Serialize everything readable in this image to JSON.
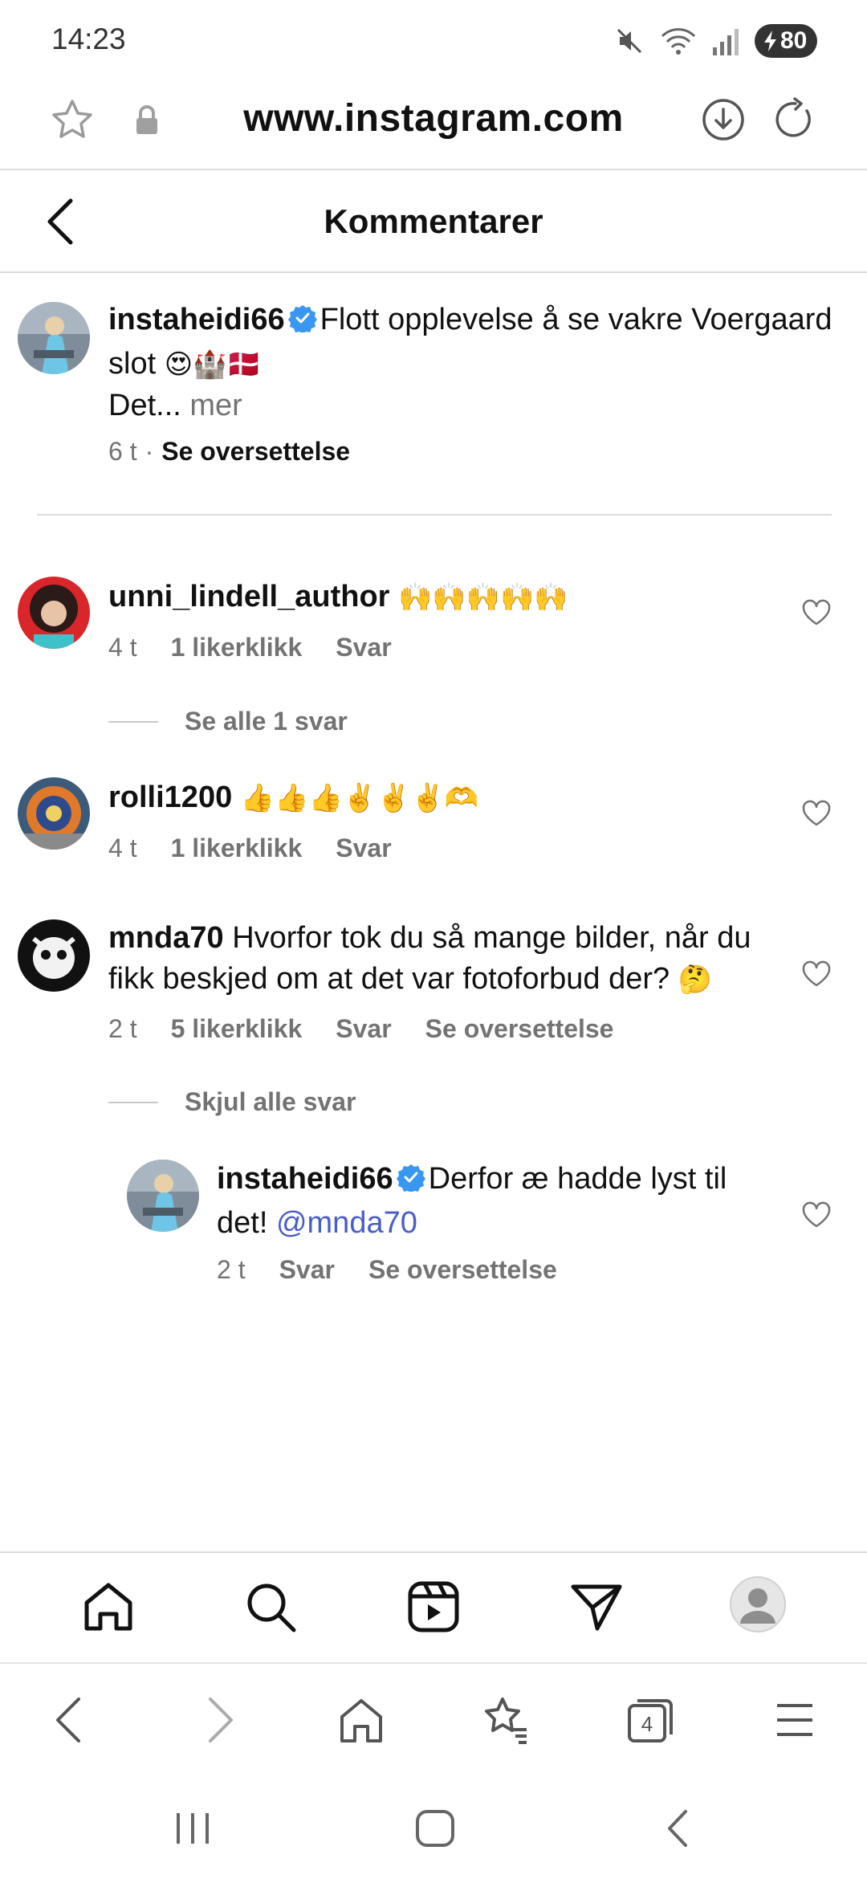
{
  "status_bar": {
    "time": "14:23",
    "battery": "80"
  },
  "browser": {
    "url": "www.instagram.com",
    "tab_count": "4"
  },
  "header": {
    "title": "Kommentarer"
  },
  "caption": {
    "username": "instaheidi66",
    "text": "Flott opplevelse å se vakre Voergaard slot",
    "emojis": "😍🏰🇩🇰",
    "more_prefix": "Det...",
    "more_label": "mer",
    "time": "6 t",
    "translate": "Se oversettelse"
  },
  "comments": [
    {
      "username": "unni_lindell_author",
      "text": "🙌🙌🙌🙌🙌",
      "time": "4 t",
      "likes": "1 likerklikk",
      "reply": "Svar",
      "replies_toggle": "Se alle 1 svar"
    },
    {
      "username": "rolli1200",
      "text": "👍👍👍✌️✌️✌️🫶",
      "time": "4 t",
      "likes": "1 likerklikk",
      "reply": "Svar"
    },
    {
      "username": "mnda70",
      "text": "Hvorfor tok du så mange bilder, når du fikk beskjed om at det var fotoforbud der?",
      "emoji": "🤔",
      "time": "2 t",
      "likes": "5 likerklikk",
      "reply": "Svar",
      "translate": "Se oversettelse",
      "replies_toggle": "Skjul alle svar",
      "replies": [
        {
          "username": "instaheidi66",
          "text": "Derfor æ hadde lyst til det!",
          "mention": "@mnda70",
          "time": "2 t",
          "reply": "Svar",
          "translate": "Se oversettelse"
        }
      ]
    }
  ],
  "icons": {
    "status": [
      "mute-icon",
      "wifi-icon",
      "signal-icon",
      "battery-icon"
    ],
    "url_bar": [
      "bookmark-star-icon",
      "lock-icon",
      "download-icon",
      "reload-icon"
    ],
    "ig_nav": [
      "home-icon",
      "search-icon",
      "reels-icon",
      "direct-message-icon",
      "profile-icon"
    ],
    "browser_nav": [
      "back-arrow-icon",
      "forward-arrow-icon",
      "home-icon",
      "bookmarks-icon",
      "tabs-icon",
      "menu-icon"
    ],
    "system_nav": [
      "recents-icon",
      "home-icon",
      "back-icon"
    ]
  },
  "colors": {
    "verified": "#3897f0",
    "mention": "#4a5ec9",
    "muted": "#737373"
  }
}
